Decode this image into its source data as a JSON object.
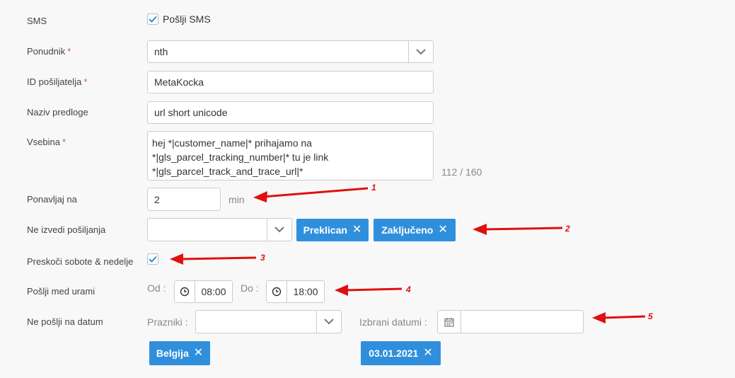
{
  "form": {
    "sms": {
      "label": "SMS",
      "checkbox_label": "Pošlji SMS",
      "checked": true
    },
    "provider": {
      "label": "Ponudnik",
      "required_mark": "*",
      "value": "nth"
    },
    "sender_id": {
      "label": "ID pošiljatelja",
      "required_mark": "*",
      "value": "MetaKocka"
    },
    "template_name": {
      "label": "Naziv predloge",
      "value": "url short unicode"
    },
    "content": {
      "label": "Vsebina",
      "required_mark": "*",
      "value": "hej *|customer_name|* prihajamo na *|gls_parcel_tracking_number|* tu je link *|gls_parcel_track_and_trace_url|*",
      "counter": "112 / 160"
    },
    "repeat": {
      "label": "Ponavljaj na",
      "value": "2",
      "unit": "min"
    },
    "no_send_status": {
      "label": "Ne izvedi pošiljanja",
      "tags": [
        "Preklican",
        "Zaključeno"
      ]
    },
    "skip_weekends": {
      "label": "Preskoči sobote & nedelje",
      "checked": true
    },
    "send_between": {
      "label": "Pošlji med urami",
      "from_label": "Od :",
      "from_value": "08:00",
      "to_label": "Do :",
      "to_value": "18:00"
    },
    "no_send_date": {
      "label": "Ne pošlji na datum",
      "holidays_label": "Prazniki :",
      "holiday_tag": "Belgija",
      "dates_label": "Izbrani datumi :",
      "date_tag": "03.01.2021"
    }
  },
  "annotations": [
    "1",
    "2",
    "3",
    "4",
    "5"
  ],
  "colors": {
    "accent": "#2f8fdc",
    "arrow": "#e01010",
    "required": "#d9534f"
  }
}
